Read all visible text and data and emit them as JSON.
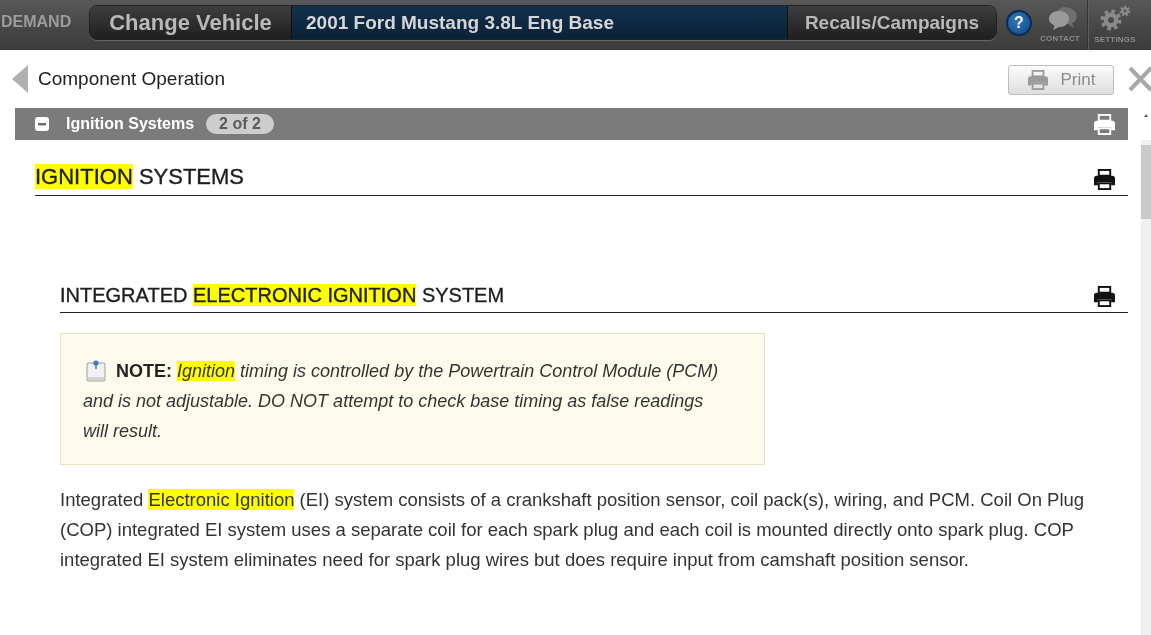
{
  "header": {
    "logo": "DEMAND",
    "change_vehicle": "Change Vehicle",
    "vehicle": "2001 Ford Mustang 3.8L Eng Base",
    "recalls": "Recalls/Campaigns",
    "help": "?",
    "contact": "CONTACT",
    "settings": "SETTINGS"
  },
  "toolbar": {
    "title": "Component Operation",
    "print": "Print"
  },
  "section": {
    "title": "Ignition Systems",
    "count": "2 of 2",
    "expanded": true
  },
  "article": {
    "heading": [
      {
        "text": "IGNITION",
        "highlighted": true
      },
      {
        "text": " SYSTEMS",
        "highlighted": false
      }
    ],
    "subheading": [
      {
        "text": "INTEGRATED ",
        "highlighted": false
      },
      {
        "text": "ELECTRONIC IGNITION",
        "highlighted": true
      },
      {
        "text": " SYSTEM",
        "highlighted": false
      }
    ],
    "note": {
      "label": "NOTE:",
      "segments": [
        {
          "text": "Ignition",
          "highlighted": true
        },
        {
          "text": " timing is controlled by the Powertrain Control Module (PCM) and is not adjustable. DO NOT attempt to check base timing as false readings will result.",
          "highlighted": false
        }
      ]
    },
    "paragraph": [
      {
        "text": "Integrated ",
        "highlighted": false
      },
      {
        "text": "Electronic Ignition",
        "highlighted": true
      },
      {
        "text": " (EI) system consists of a crankshaft position sensor, coil pack(s), wiring, and PCM. Coil On Plug (COP) integrated EI system uses a separate coil for each spark plug and each coil is mounted directly onto spark plug. COP integrated EI system eliminates need for spark plug wires but does require input from camshaft position sensor.",
        "highlighted": false
      }
    ]
  }
}
